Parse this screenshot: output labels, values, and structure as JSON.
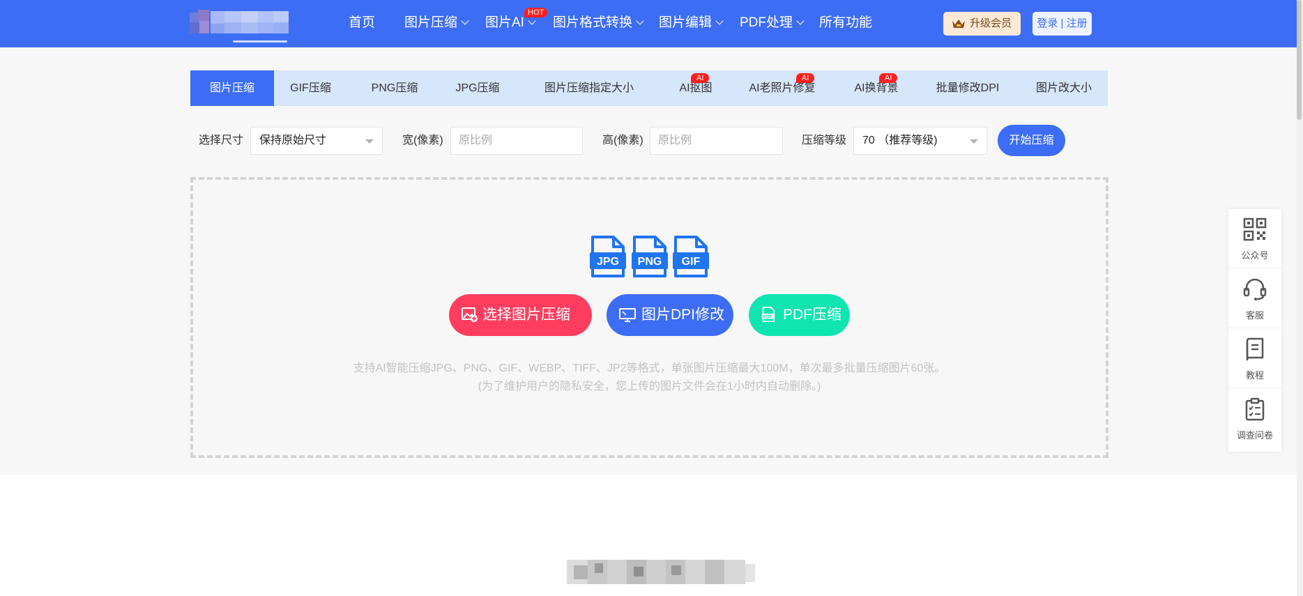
{
  "nav": {
    "items": [
      {
        "label": "首页",
        "has_dropdown": false
      },
      {
        "label": "图片压缩",
        "has_dropdown": true
      },
      {
        "label": "图片AI",
        "has_dropdown": true,
        "badge": "HOT"
      },
      {
        "label": "图片格式转换",
        "has_dropdown": true
      },
      {
        "label": "图片编辑",
        "has_dropdown": true
      },
      {
        "label": "PDF处理",
        "has_dropdown": true
      },
      {
        "label": "所有功能",
        "has_dropdown": false
      }
    ],
    "vip_label": "升级会员",
    "login_label": "登录 | 注册"
  },
  "tabs": [
    {
      "label": "图片压缩",
      "active": true
    },
    {
      "label": "GIF压缩"
    },
    {
      "label": "PNG压缩"
    },
    {
      "label": "JPG压缩"
    },
    {
      "label": "图片压缩指定大小"
    },
    {
      "label": "AI抠图",
      "badge": "AI"
    },
    {
      "label": "AI老照片修复",
      "badge": "AI"
    },
    {
      "label": "AI换背景",
      "badge": "AI"
    },
    {
      "label": "批量修改DPI"
    },
    {
      "label": "图片改大小"
    }
  ],
  "options": {
    "size_label": "选择尺寸",
    "size_value": "保持原始尺寸",
    "width_label": "宽(像素)",
    "width_placeholder": "原比例",
    "height_label": "高(像素)",
    "height_placeholder": "原比例",
    "level_label": "压缩等级",
    "level_value": "70 （推荐等级)",
    "start_label": "开始压缩"
  },
  "dropzone": {
    "file_types": [
      "JPG",
      "PNG",
      "GIF"
    ],
    "buttons": {
      "select": "选择图片压缩",
      "dpi": "图片DPI修改",
      "pdf": "PDF压缩"
    },
    "hint_line1": "支持AI智能压缩JPG、PNG、GIF、WEBP、TIFF、JP2等格式，单张图片压缩最大100M，单次最多批量压缩图片60张。",
    "hint_line2": "(为了维护用户的隐私安全，您上传的图片文件会在1小时内自动删除。)"
  },
  "side_panel": [
    {
      "label": "公众号",
      "icon": "qrcode-icon"
    },
    {
      "label": "客服",
      "icon": "headset-icon"
    },
    {
      "label": "教程",
      "icon": "book-icon"
    },
    {
      "label": "调查问卷",
      "icon": "clipboard-icon"
    }
  ],
  "colors": {
    "brand": "#3d6df5",
    "tab_bg": "#d6e6fb",
    "select_button": "#ff3d5e",
    "dpi_button": "#3d6df5",
    "pdf_button": "#0ee5b0",
    "badge_red": "#ff1f1f"
  }
}
